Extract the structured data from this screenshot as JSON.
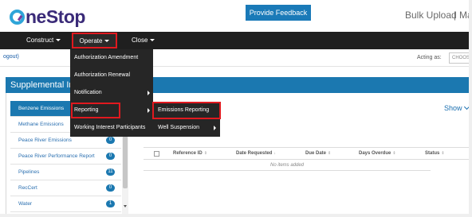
{
  "header": {
    "logo_text": "neStop",
    "feedback_label": "Provide Feedback",
    "bulk_upload": "Bulk Upload",
    "separator": "|",
    "ma_link": "Ma"
  },
  "nav": {
    "construct": "Construct",
    "operate": "Operate",
    "close": "Close"
  },
  "subbar": {
    "logout": "ogout)",
    "acting_as": "Acting as:",
    "choose": "CHOOSE"
  },
  "panel": {
    "title": "Supplemental Inf"
  },
  "sidebar": {
    "items": [
      {
        "label": "Benzene Emissions",
        "badge": ""
      },
      {
        "label": "Methane Emissions",
        "badge": ""
      },
      {
        "label": "Peace River Emissions",
        "badge": "0"
      },
      {
        "label": "Peace River Performance Report",
        "badge": "0"
      },
      {
        "label": "Pipelines",
        "badge": "11"
      },
      {
        "label": "RecCert",
        "badge": "0"
      },
      {
        "label": "Water",
        "badge": "1"
      }
    ]
  },
  "table": {
    "show_label": "Show",
    "columns": [
      "Reference ID",
      "Date Requested",
      "Due Date",
      "Days Overdue",
      "Status"
    ],
    "sort_glyphs": [
      "⇕",
      "↓",
      "⇕",
      "⇕",
      "⇕"
    ],
    "empty_text": "No items added"
  },
  "operate_menu": {
    "items": [
      {
        "label": "Authorization Amendment"
      },
      {
        "label": "Authorization Renewal"
      },
      {
        "label": "Notification"
      },
      {
        "label": "Reporting"
      },
      {
        "label": "Working Interest Participants"
      }
    ]
  },
  "reporting_submenu": {
    "items": [
      {
        "label": "Emissions Reporting"
      },
      {
        "label": "Well Suspension"
      }
    ]
  },
  "colors": {
    "nav_bg": "#1f1f1f",
    "accent_blue": "#1b78b0",
    "highlight_red": "#e0191f",
    "logo_purple": "#3a2a78"
  }
}
